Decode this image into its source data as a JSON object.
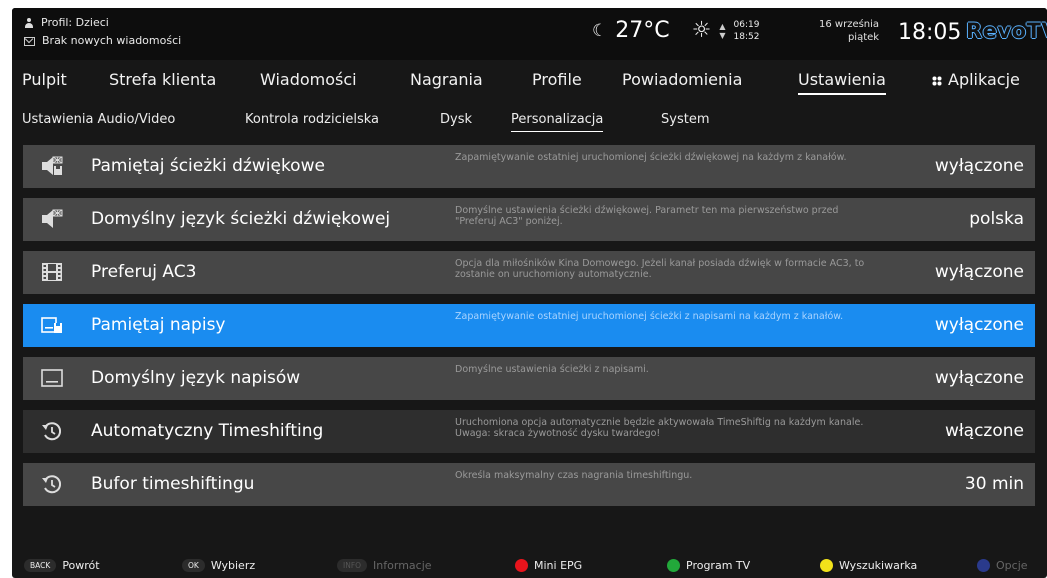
{
  "header": {
    "profile": "Profil: Dzieci",
    "messages": "Brak nowych wiadomości",
    "temperature": "27°C",
    "sunrise": "06:19",
    "sunset": "18:52",
    "date": "16 września",
    "weekday": "piątek",
    "time": "18:05",
    "brand": "RevoTV"
  },
  "mainnav": [
    "Pulpit",
    "Strefa klienta",
    "Wiadomości",
    "Nagrania",
    "Profile",
    "Powiadomienia",
    "Ustawienia",
    "Aplikacje"
  ],
  "subnav": [
    "Ustawienia Audio/Video",
    "Kontrola rodzicielska",
    "Dysk",
    "Personalizacja",
    "System"
  ],
  "rows": [
    {
      "label": "Pamiętaj ścieżki dźwiękowe",
      "desc": "Zapamiętywanie ostatniej uruchomionej ścieżki dźwiękowej na każdym z kanałów.",
      "value": "wyłączone"
    },
    {
      "label": "Domyślny język ścieżki dźwiękowej",
      "desc": "Domyślne ustawienia ścieżki dźwiękowej. Parametr ten ma pierwszeństwo przed \"Preferuj AC3\" poniżej.",
      "value": "polska"
    },
    {
      "label": "Preferuj AC3",
      "desc": "Opcja dla miłośników Kina Domowego. Jeżeli kanał posiada dźwięk w formacie AC3, to zostanie on uruchomiony automatycznie.",
      "value": "wyłączone"
    },
    {
      "label": "Pamiętaj napisy",
      "desc": "Zapamiętywanie ostatniej uruchomionej ścieżki z napisami na każdym z kanałów.",
      "value": "wyłączone"
    },
    {
      "label": "Domyślny język napisów",
      "desc": "Domyślne ustawienia ścieżki z napisami.",
      "value": "wyłączone"
    },
    {
      "label": "Automatyczny Timeshifting",
      "desc": "Uruchomiona opcja automatycznie będzie aktywowała TimeShiftig na każdym kanale. Uwaga: skraca żywotność dysku twardego!",
      "value": "włączone"
    },
    {
      "label": "Bufor timeshiftingu",
      "desc": "Określa maksymalny czas nagrania timeshiftingu.",
      "value": "30 min"
    }
  ],
  "footer": {
    "back_key": "BACK",
    "back_label": "Powrót",
    "ok_key": "OK",
    "ok_label": "Wybierz",
    "info_key": "INFO",
    "info_label": "Informacje",
    "red_label": "Mini EPG",
    "green_label": "Program TV",
    "yellow_label": "Wyszukiwarka",
    "blue_label": "Opcje"
  },
  "colors": {
    "selected": "#1a8cf0",
    "red": "#e8141c",
    "green": "#22a83a",
    "yellow": "#f2e21a",
    "blue": "#2a3a8c"
  },
  "icons": [
    "speaker-flag-icon",
    "speaker-flag-icon",
    "film-strip-icon",
    "subtitle-save-icon",
    "subtitle-icon",
    "timeshift-icon",
    "timeshift-icon"
  ]
}
